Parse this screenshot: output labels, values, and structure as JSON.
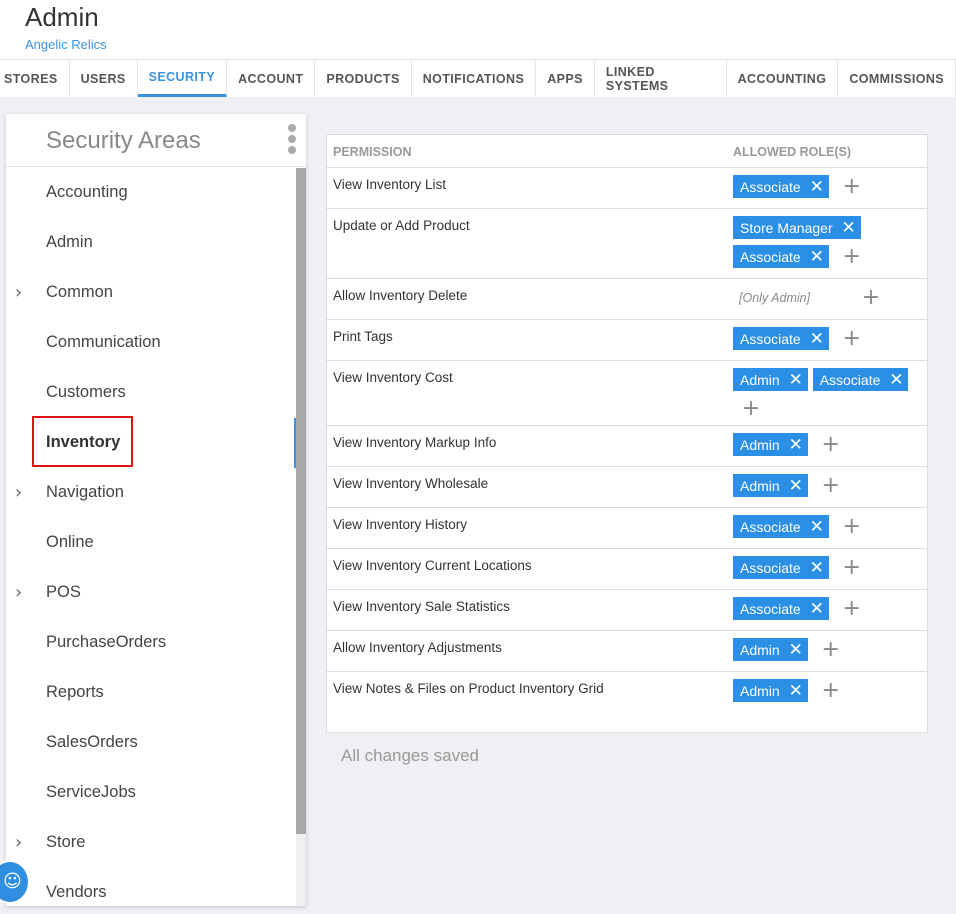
{
  "header": {
    "title": "Admin",
    "subtitle": "Angelic Relics"
  },
  "tabs": [
    "STORES",
    "USERS",
    "SECURITY",
    "ACCOUNT",
    "PRODUCTS",
    "NOTIFICATIONS",
    "APPS",
    "LINKED SYSTEMS",
    "ACCOUNTING",
    "COMMISSIONS"
  ],
  "active_tab": "SECURITY",
  "sidebar": {
    "title": "Security Areas",
    "items": [
      {
        "label": "Accounting",
        "expandable": false
      },
      {
        "label": "Admin",
        "expandable": false
      },
      {
        "label": "Common",
        "expandable": true
      },
      {
        "label": "Communication",
        "expandable": false
      },
      {
        "label": "Customers",
        "expandable": false
      },
      {
        "label": "Inventory",
        "expandable": false,
        "selected": true
      },
      {
        "label": "Navigation",
        "expandable": true
      },
      {
        "label": "Online",
        "expandable": false
      },
      {
        "label": "POS",
        "expandable": true
      },
      {
        "label": "PurchaseOrders",
        "expandable": false
      },
      {
        "label": "Reports",
        "expandable": false
      },
      {
        "label": "SalesOrders",
        "expandable": false
      },
      {
        "label": "ServiceJobs",
        "expandable": false
      },
      {
        "label": "Store",
        "expandable": true
      },
      {
        "label": "Vendors",
        "expandable": false
      }
    ]
  },
  "permissions": {
    "header_permission": "PERMISSION",
    "header_roles": "ALLOWED ROLE(S)",
    "rows": [
      {
        "name": "View Inventory List",
        "roles": [
          "Associate"
        ]
      },
      {
        "name": "Update or Add Product",
        "roles": [
          "Store Manager",
          "Associate"
        ]
      },
      {
        "name": "Allow Inventory Delete",
        "roles": [],
        "note": "[Only Admin]"
      },
      {
        "name": "Print Tags",
        "roles": [
          "Associate"
        ]
      },
      {
        "name": "View Inventory Cost",
        "roles": [
          "Admin",
          "Associate"
        ]
      },
      {
        "name": "View Inventory Markup Info",
        "roles": [
          "Admin"
        ]
      },
      {
        "name": "View Inventory Wholesale",
        "roles": [
          "Admin"
        ]
      },
      {
        "name": "View Inventory History",
        "roles": [
          "Associate"
        ]
      },
      {
        "name": "View Inventory Current Locations",
        "roles": [
          "Associate"
        ]
      },
      {
        "name": "View Inventory Sale Statistics",
        "roles": [
          "Associate"
        ]
      },
      {
        "name": "Allow Inventory Adjustments",
        "roles": [
          "Admin"
        ]
      },
      {
        "name": "View Notes & Files on Product Inventory Grid",
        "roles": [
          "Admin"
        ]
      }
    ]
  },
  "status": {
    "saved_text": "All changes saved"
  },
  "icons": {
    "chevron": "chevron-right-icon",
    "remove": "close-icon",
    "add": "plus-icon",
    "menu": "kebab-menu-icon",
    "help": "chat-help-icon"
  },
  "colors": {
    "accent": "#3a93e0",
    "chip": "#2b8fe6",
    "highlight": "#dd1111"
  }
}
